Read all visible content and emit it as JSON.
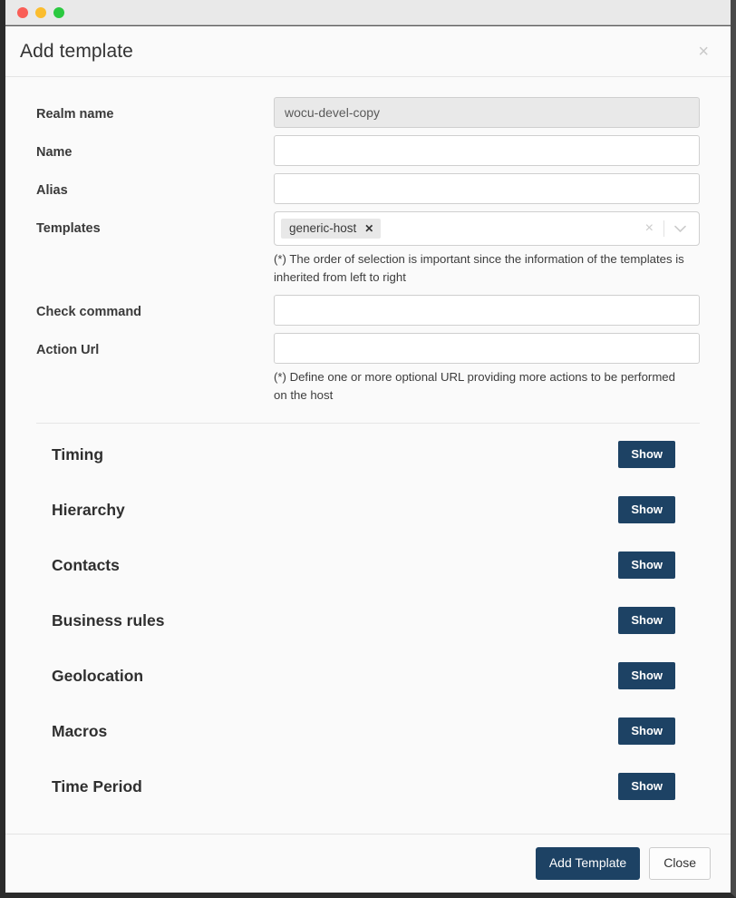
{
  "window": {
    "traffic_lights": [
      {
        "name": "close",
        "color": "#fa5e57"
      },
      {
        "name": "minimize",
        "color": "#fbbd2e"
      },
      {
        "name": "zoom",
        "color": "#2bc940"
      }
    ]
  },
  "modal": {
    "title": "Add template",
    "close_label": "×",
    "form": {
      "realm_name": {
        "label": "Realm name",
        "value": "wocu-devel-copy",
        "disabled": true
      },
      "name": {
        "label": "Name",
        "value": "",
        "placeholder": ""
      },
      "alias": {
        "label": "Alias",
        "value": "",
        "placeholder": ""
      },
      "templates": {
        "label": "Templates",
        "tags": [
          "generic-host"
        ],
        "tag_remove_label": "✕",
        "clear_label": "×",
        "help": "(*) The order of selection is important since the information of the templates is inherited from left to right"
      },
      "check_command": {
        "label": "Check command",
        "value": "",
        "placeholder": ""
      },
      "action_url": {
        "label": "Action Url",
        "value": "",
        "placeholder": "",
        "help": "(*) Define one or more optional URL providing more actions to be performed on the host"
      }
    },
    "sections": [
      {
        "title": "Timing",
        "button": "Show"
      },
      {
        "title": "Hierarchy",
        "button": "Show"
      },
      {
        "title": "Contacts",
        "button": "Show"
      },
      {
        "title": "Business rules",
        "button": "Show"
      },
      {
        "title": "Geolocation",
        "button": "Show"
      },
      {
        "title": "Macros",
        "button": "Show"
      },
      {
        "title": "Time Period",
        "button": "Show"
      }
    ],
    "footer": {
      "submit_label": "Add Template",
      "close_label": "Close"
    }
  },
  "colors": {
    "primary": "#1d4264",
    "modal_bg": "#fafafa",
    "disabled_field": "#e9e9e9",
    "tag_bg": "#e8e8e8"
  }
}
